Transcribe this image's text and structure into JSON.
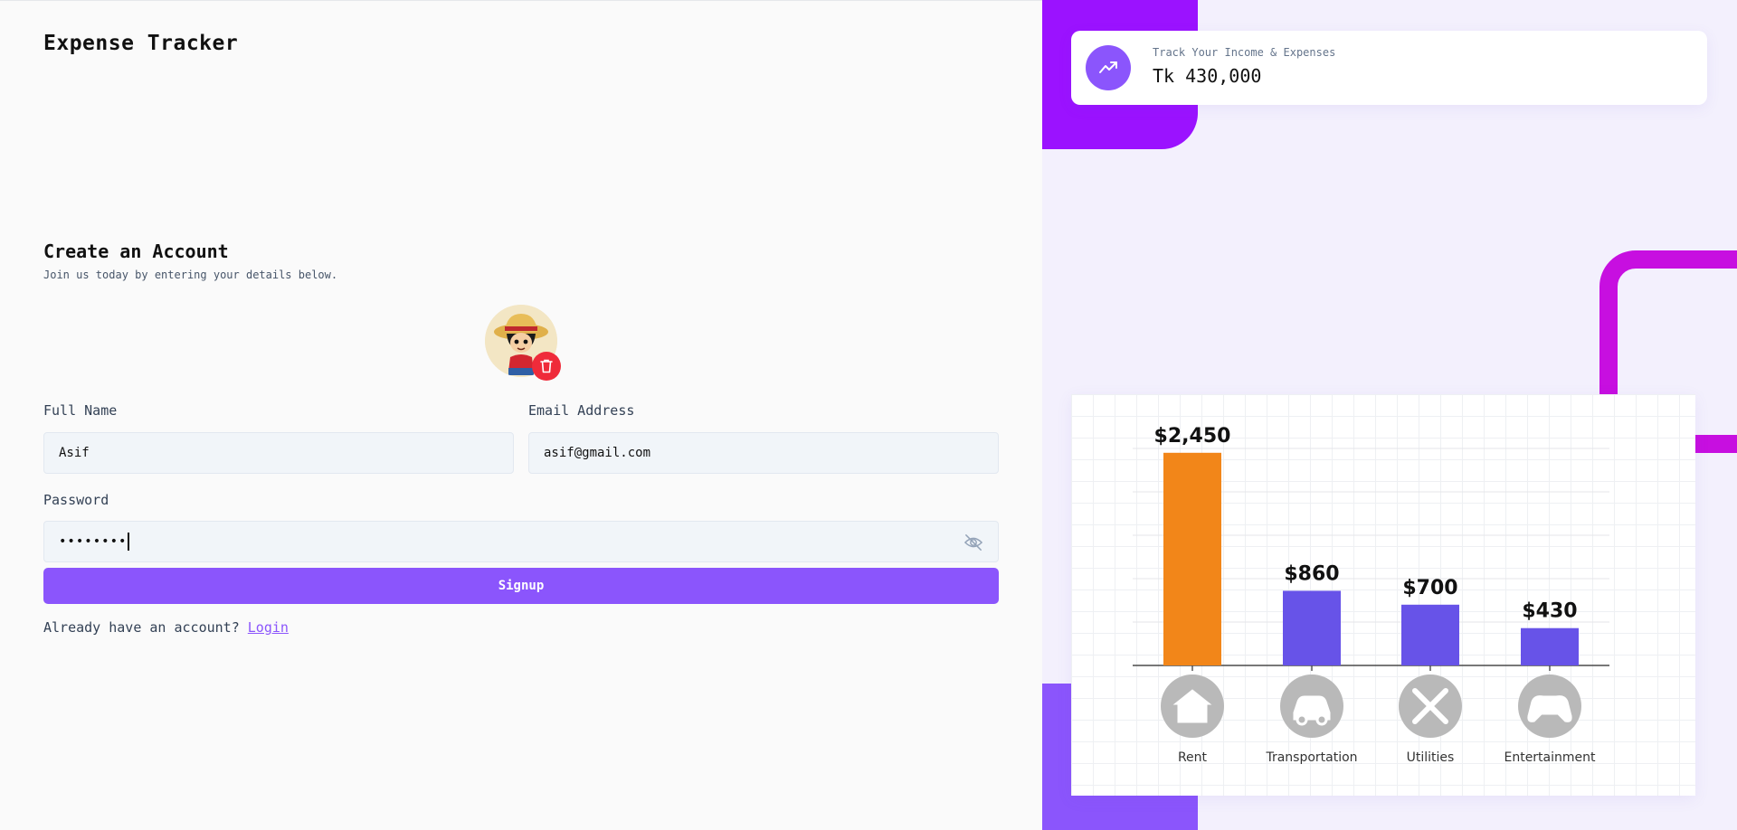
{
  "app": {
    "title": "Expense Tracker"
  },
  "form": {
    "heading": "Create an Account",
    "subheading": "Join us today by entering your details below.",
    "full_name": {
      "label": "Full Name",
      "value": "Asif"
    },
    "email": {
      "label": "Email Address",
      "value": "asif@gmail.com"
    },
    "password": {
      "label": "Password",
      "value": "••••••••"
    },
    "signup_label": "Signup",
    "login_prompt": "Already have an account?",
    "login_link": "Login"
  },
  "stat_card": {
    "label": "Track Your Income & Expenses",
    "value": "Tk 430,000",
    "icon": "trend-up-icon"
  },
  "colors": {
    "accent": "#8b55fc",
    "delete": "#ef2b3a",
    "highlight_bar": "#f28619",
    "bar": "#6753e8"
  },
  "chart_data": {
    "type": "bar",
    "categories": [
      "Rent",
      "Transportation",
      "Utilities",
      "Entertainment"
    ],
    "values": [
      2450,
      860,
      700,
      430
    ],
    "data_labels": [
      "$2,450",
      "$860",
      "$700",
      "$430"
    ],
    "category_icons": [
      "house-icon",
      "car-icon",
      "tools-icon",
      "gamepad-icon"
    ],
    "ylim": [
      0,
      2500
    ],
    "grid": true,
    "legend": "none"
  }
}
